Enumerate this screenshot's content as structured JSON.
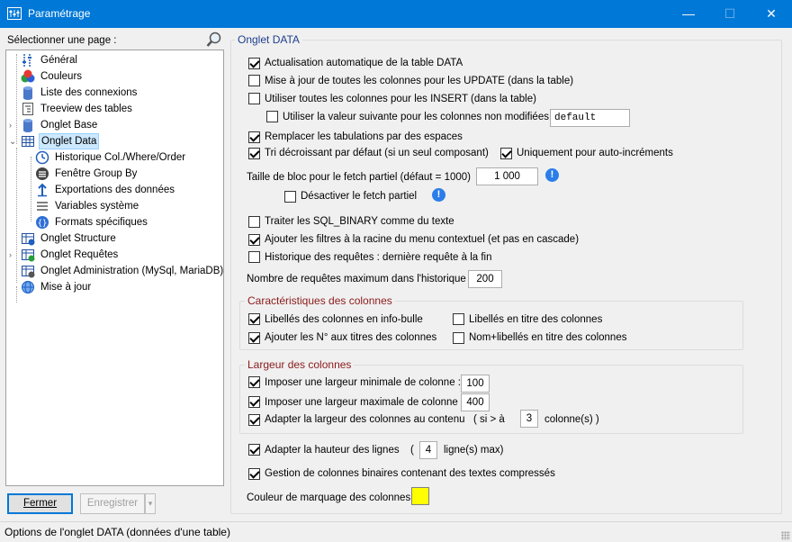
{
  "window": {
    "title": "Paramétrage",
    "minimize": "—",
    "maximize": "☐",
    "close": "✕"
  },
  "sidebar": {
    "header": "Sélectionner une page :",
    "items": [
      {
        "label": "Général",
        "icon": "sliders-icon"
      },
      {
        "label": "Couleurs",
        "icon": "palette-icon"
      },
      {
        "label": "Liste des connexions",
        "icon": "database-icon"
      },
      {
        "label": "Treeview des tables",
        "icon": "tree-document-icon"
      },
      {
        "label": "Onglet Base",
        "icon": "database-icon"
      },
      {
        "label": "Onglet Data",
        "icon": "grid-icon",
        "selected": true
      },
      {
        "label": "Historique Col./Where/Order",
        "icon": "clock-icon"
      },
      {
        "label": "Fenêtre Group By",
        "icon": "group-icon"
      },
      {
        "label": "Exportations des données",
        "icon": "export-arrow-icon"
      },
      {
        "label": "Variables système",
        "icon": "list-icon"
      },
      {
        "label": "Formats spécifiques",
        "icon": "braces-icon"
      },
      {
        "label": "Onglet Structure",
        "icon": "structure-icon"
      },
      {
        "label": "Onglet Requêtes",
        "icon": "query-icon"
      },
      {
        "label": "Onglet Administration (MySql, MariaDB)",
        "icon": "admin-icon"
      },
      {
        "label": "Mise à jour",
        "icon": "globe-icon"
      }
    ]
  },
  "buttons": {
    "close": "Fermer",
    "save": "Enregistrer",
    "save_dropdown": "▾"
  },
  "panel": {
    "title": "Onglet DATA",
    "options": {
      "auto_refresh": {
        "label": "Actualisation automatique de la table DATA",
        "checked": true
      },
      "update_all": {
        "label": "Mise à jour de toutes les colonnes pour les UPDATE (dans la table)",
        "checked": false
      },
      "insert_all": {
        "label": "Utiliser toutes les colonnes pour les INSERT (dans la table)",
        "checked": false
      },
      "default_value": {
        "label": "Utiliser la valeur suivante pour les colonnes non modifiées :",
        "checked": false,
        "value": "default"
      },
      "replace_tabs": {
        "label": "Remplacer les tabulations par des espaces",
        "checked": true
      },
      "sort_desc": {
        "label": "Tri décroissant par défaut (si un seul composant)",
        "checked": true
      },
      "auto_increment": {
        "label": "Uniquement pour auto-incréments",
        "checked": true
      },
      "fetch_block": {
        "label": "Taille de bloc pour le fetch partiel (défaut = 1000)",
        "value": "1 000"
      },
      "disable_fetch": {
        "label": "Désactiver le fetch partiel",
        "checked": false
      },
      "sql_binary": {
        "label": "Traiter les SQL_BINARY comme du texte",
        "checked": false
      },
      "root_filters": {
        "label": "Ajouter les filtres à la racine du menu contextuel (et pas en cascade)",
        "checked": true
      },
      "history_last": {
        "label": "Historique des requêtes : dernière requête à la fin",
        "checked": false
      },
      "max_queries": {
        "label": "Nombre de requêtes maximum dans l'historique :",
        "value": "200"
      }
    },
    "columns_group": {
      "title": "Caractéristiques des colonnes",
      "tooltip_labels": {
        "label": "Libellés des colonnes en info-bulle",
        "checked": true
      },
      "title_labels": {
        "label": "Libellés en titre des colonnes",
        "checked": false
      },
      "add_numbers": {
        "label": "Ajouter les N° aux titres des colonnes",
        "checked": true
      },
      "num_labels": {
        "label": "Nom+libellés en titre des colonnes",
        "checked": false
      }
    },
    "width_group": {
      "title": "Largeur des colonnes",
      "min_width": {
        "label": "Imposer une largeur minimale de colonne :",
        "checked": true,
        "value": "100"
      },
      "max_width": {
        "label": "Imposer une largeur maximale de colonne :",
        "checked": true,
        "value": "400"
      },
      "fit_content": {
        "label": "Adapter la largeur des colonnes au contenu",
        "checked": true,
        "prefix": "( si > à",
        "value": "3",
        "suffix": "colonne(s) )"
      }
    },
    "row_height": {
      "label": "Adapter la hauteur des lignes",
      "checked": true,
      "prefix": "(",
      "value": "4",
      "suffix": "ligne(s) max)"
    },
    "binary_columns": {
      "label": "Gestion de colonnes binaires contenant des textes compressés",
      "checked": true
    },
    "marker_color": {
      "label": "Couleur de marquage des colonnes :",
      "color": "#ffff00"
    }
  },
  "status": "Options de l'onglet DATA (données d'une table)"
}
